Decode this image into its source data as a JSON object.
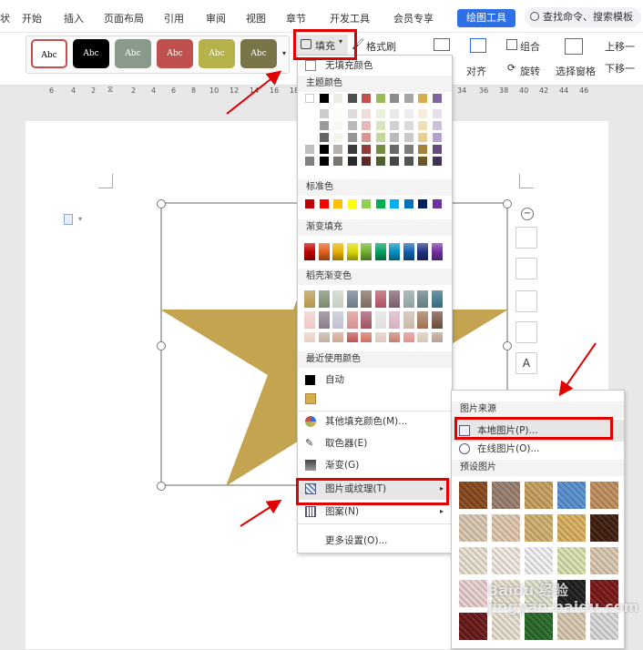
{
  "tabs": {
    "items": [
      "开始",
      "插入",
      "页面布局",
      "引用",
      "审阅",
      "视图",
      "章节",
      "开发工具",
      "会员专享"
    ],
    "active": "绘图工具",
    "search": "查找命令、搜索模板",
    "left_fragment": "状"
  },
  "ribbon": {
    "shape_style_label": "Abc",
    "fill": "填充",
    "format_painter": "格式刷",
    "group": "组合",
    "align": "对齐",
    "rotate": "旋转",
    "select_pane": "选择窗格",
    "move_up": "上移一",
    "move_down": "下移一"
  },
  "ruler": {
    "ticks": [
      "6",
      "4",
      "2",
      "2",
      "4",
      "6",
      "8",
      "10",
      "12",
      "14",
      "16",
      "18",
      "34",
      "36",
      "38",
      "40",
      "42",
      "44",
      "46"
    ]
  },
  "fill_menu": {
    "no_fill": "无填充颜色",
    "theme_colors": "主题颜色",
    "standard_colors": "标准色",
    "gradient_fill": "渐变填充",
    "docer_gradient": "稻壳渐变色",
    "recent_colors": "最近使用颜色",
    "auto": "自动",
    "more_colors": "其他填充颜色(M)...",
    "eyedropper": "取色器(E)",
    "gradient": "渐变(G)",
    "picture_texture": "图片或纹理(T)",
    "pattern": "图案(N)",
    "more_settings": "更多设置(O)...",
    "theme_row": [
      "#ffffff",
      "#000000",
      "#eeece1",
      "#4f4f4f",
      "#c0504d",
      "#9bbb59",
      "#8c8c8c",
      "#a5a5a5",
      "#d6ae4e",
      "#8064a2"
    ],
    "standard_row": [
      "#c00000",
      "#ff0000",
      "#ffc000",
      "#ffff00",
      "#92d050",
      "#00b050",
      "#00b0f0",
      "#0070c0",
      "#002060",
      "#7030a0"
    ],
    "gradient_row": [
      "#c00000",
      "#e06020",
      "#e8b000",
      "#d8d800",
      "#70b030",
      "#00a060",
      "#0090c0",
      "#1060b0",
      "#203080",
      "#7030a0"
    ],
    "recent_row": [
      "#000000",
      "#d6ae4e"
    ]
  },
  "picture_submenu": {
    "source": "图片来源",
    "local": "本地图片(P)...",
    "online": "在线图片(O)...",
    "preset": "预设图片"
  },
  "watermark": "Baidu 经验\njingyan.baidu.com"
}
